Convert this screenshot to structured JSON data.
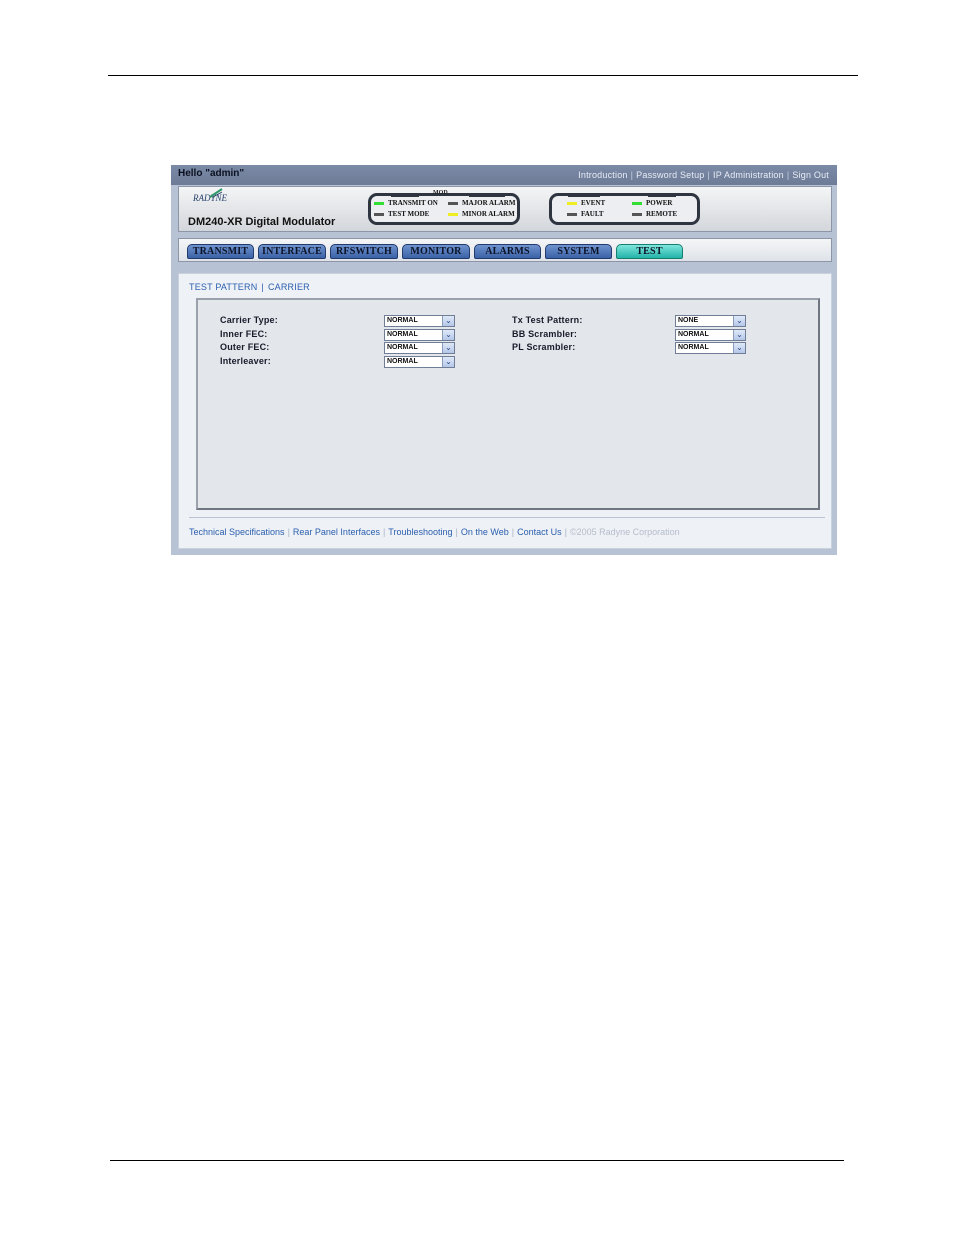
{
  "topbar": {
    "greeting": "Hello \"admin\"",
    "links": [
      "Introduction",
      "Password Setup",
      "IP Administration",
      "Sign Out"
    ]
  },
  "header": {
    "logo": "RADYNE",
    "product_name": "DM240-XR Digital Modulator",
    "mod_group": {
      "title": "MOD",
      "leds": [
        {
          "label": "TRANSMIT ON",
          "color": "#33dd33"
        },
        {
          "label": "MAJOR ALARM",
          "color": "#555555"
        },
        {
          "label": "TEST MODE",
          "color": "#555555"
        },
        {
          "label": "MINOR ALARM",
          "color": "#eeee22"
        }
      ]
    },
    "status_group": {
      "leds": [
        {
          "label": "EVENT",
          "color": "#eeee22"
        },
        {
          "label": "POWER",
          "color": "#33dd33"
        },
        {
          "label": "FAULT",
          "color": "#555555"
        },
        {
          "label": "REMOTE",
          "color": "#555555"
        }
      ]
    }
  },
  "tabs": [
    {
      "label": "TRANSMIT",
      "active": false
    },
    {
      "label": "INTERFACE",
      "active": false
    },
    {
      "label": "RFSWITCH",
      "active": false
    },
    {
      "label": "MONITOR",
      "active": false
    },
    {
      "label": "ALARMS",
      "active": false
    },
    {
      "label": "SYSTEM",
      "active": false
    },
    {
      "label": "TEST",
      "active": true
    }
  ],
  "subnav": [
    "TEST PATTERN",
    "CARRIER"
  ],
  "form": {
    "left": [
      {
        "label": "Carrier Type:",
        "value": "NORMAL"
      },
      {
        "label": "Inner FEC:",
        "value": "NORMAL"
      },
      {
        "label": "Outer FEC:",
        "value": "NORMAL"
      },
      {
        "label": "Interleaver:",
        "value": "NORMAL"
      }
    ],
    "right": [
      {
        "label": "Tx Test Pattern:",
        "value": "NONE"
      },
      {
        "label": "BB Scrambler:",
        "value": "NORMAL"
      },
      {
        "label": "PL Scrambler:",
        "value": "NORMAL"
      }
    ]
  },
  "footer": {
    "links": [
      "Technical Specifications",
      "Rear Panel Interfaces",
      "Troubleshooting",
      "On the Web",
      "Contact Us"
    ],
    "copyright": "©2005 Radyne Corporation"
  }
}
